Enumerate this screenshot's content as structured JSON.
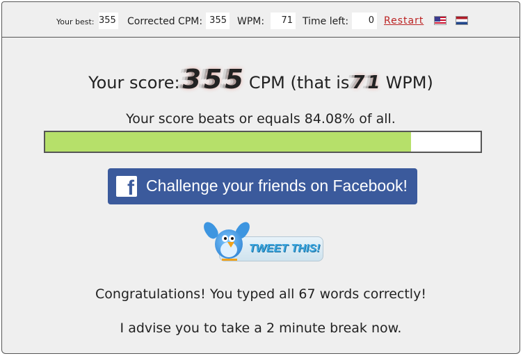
{
  "topbar": {
    "best_label": "Your best:",
    "best_value": "355",
    "cpm_label": "Corrected CPM:",
    "cpm_value": "355",
    "wpm_label": "WPM:",
    "wpm_value": "71",
    "time_label": "Time left:",
    "time_value": "0",
    "restart_label": "Restart",
    "flags": [
      "us-flag-icon",
      "nl-flag-icon"
    ]
  },
  "result": {
    "score_prefix": "Your score:",
    "cpm": "355",
    "cpm_unit": "CPM (that is",
    "wpm": "71",
    "wpm_unit": "WPM)",
    "beats_text": "Your score beats or equals 84.08% of all.",
    "percentile": 84.08,
    "progress_color": "#b6e06a"
  },
  "share": {
    "facebook_label": "Challenge your friends on Facebook!",
    "facebook_icon": "facebook-icon",
    "facebook_color": "#3b5a9c",
    "tweet_label": "TWEET THIS!",
    "tweet_icon": "twitter-bird-icon"
  },
  "messages": {
    "congrats": "Congratulations! You typed all 67 words correctly!",
    "advice": "I advise you to take a 2 minute break now."
  }
}
